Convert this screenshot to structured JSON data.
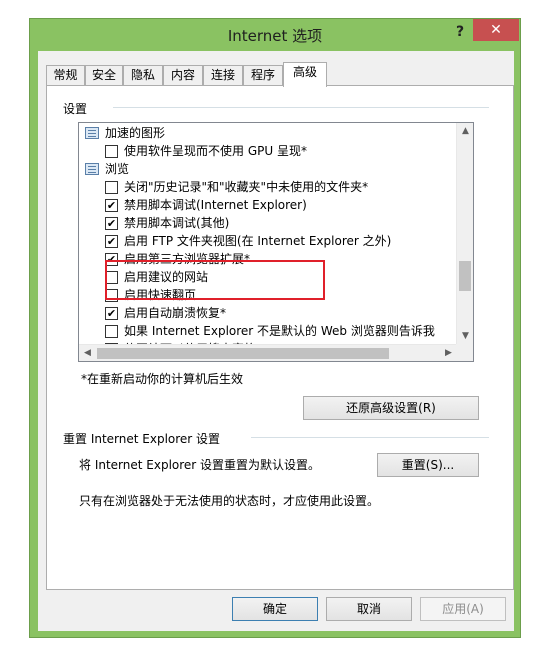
{
  "window": {
    "title": "Internet 选项",
    "help_glyph": "?",
    "close_glyph": "✕"
  },
  "tabs": [
    {
      "label": "常规"
    },
    {
      "label": "安全"
    },
    {
      "label": "隐私"
    },
    {
      "label": "内容"
    },
    {
      "label": "连接"
    },
    {
      "label": "程序"
    },
    {
      "label": "高级",
      "active": true
    }
  ],
  "settings": {
    "heading": "设置",
    "items": [
      {
        "kind": "category",
        "label": "加速的图形",
        "icon": "category-icon"
      },
      {
        "kind": "option",
        "label": "使用软件呈现而不使用 GPU 呈现*",
        "checked": false
      },
      {
        "kind": "category",
        "label": "浏览",
        "icon": "category-icon"
      },
      {
        "kind": "option",
        "label": "关闭\"历史记录\"和\"收藏夹\"中未使用的文件夹*",
        "checked": false
      },
      {
        "kind": "option",
        "label": "禁用脚本调试(Internet Explorer)",
        "checked": true
      },
      {
        "kind": "option",
        "label": "禁用脚本调试(其他)",
        "checked": true
      },
      {
        "kind": "option",
        "label": "启用 FTP 文件夹视图(在 Internet Explorer 之外)",
        "checked": true
      },
      {
        "kind": "option",
        "label": "启用第三方浏览器扩展*",
        "checked": true
      },
      {
        "kind": "option",
        "label": "启用建议的网站",
        "checked": false
      },
      {
        "kind": "option",
        "label": "启用快速翻页",
        "checked": false
      },
      {
        "kind": "option",
        "label": "启用自动崩溃恢复*",
        "checked": true
      },
      {
        "kind": "option",
        "label": "如果 Internet Explorer 不是默认的 Web 浏览器则告诉我",
        "checked": false
      },
      {
        "kind": "option",
        "label": "使网站可以使用搜索窗格*",
        "checked": false
      }
    ],
    "restart_note": "*在重新启动你的计算机后生效",
    "restore_button": "还原高级设置(R)"
  },
  "reset": {
    "heading": "重置 Internet Explorer 设置",
    "description": "将 Internet Explorer 设置重置为默认设置。",
    "button": "重置(S)...",
    "note": "只有在浏览器处于无法使用的状态时，才应使用此设置。"
  },
  "footer": {
    "ok": "确定",
    "cancel": "取消",
    "apply": "应用(A)"
  }
}
